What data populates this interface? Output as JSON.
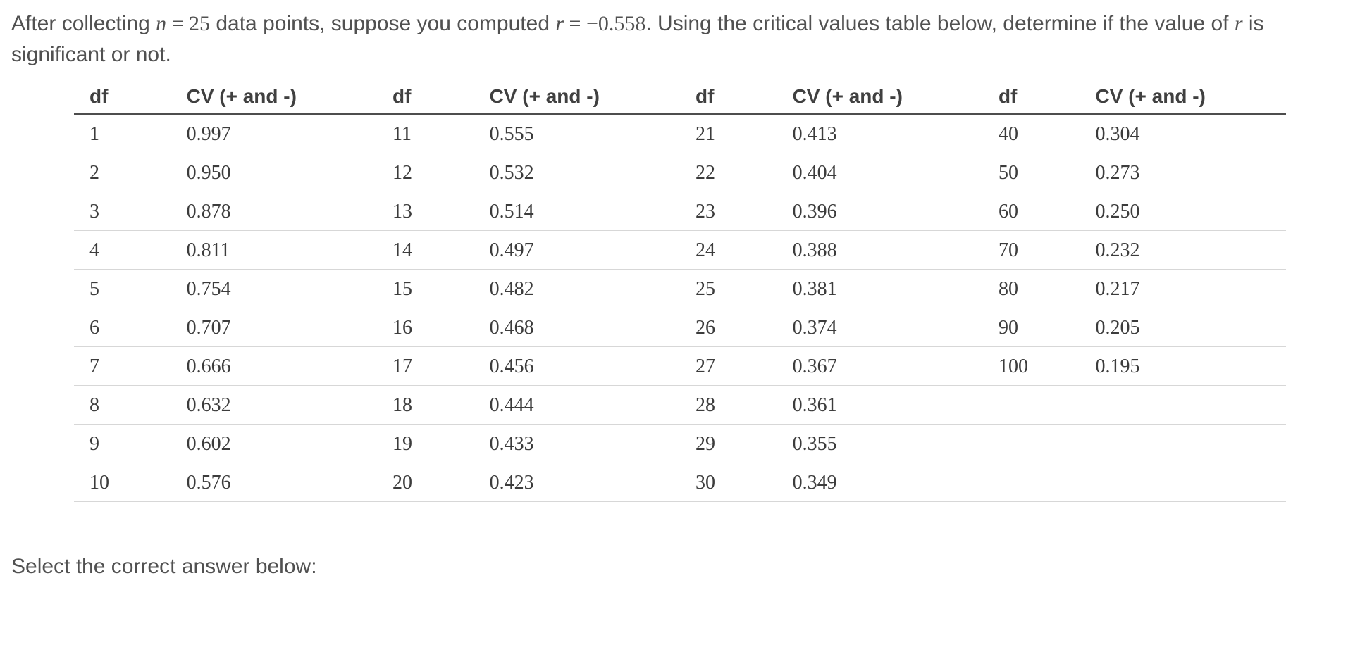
{
  "question": {
    "part1": "After collecting ",
    "n_var": "n",
    "eq1": " = ",
    "n_val": "25",
    "part2": " data points, suppose you computed ",
    "r_var": "r",
    "eq2": " = ",
    "r_val": "−0.558",
    "part3": ". Using the critical values table below, determine if the value of ",
    "r_var2": "r",
    "part4": " is significant or not."
  },
  "headers": {
    "df": "df",
    "cv": "CV (+ and -)"
  },
  "table_rows": [
    {
      "c0_df": "1",
      "c0_cv": "0.997",
      "c1_df": "11",
      "c1_cv": "0.555",
      "c2_df": "21",
      "c2_cv": "0.413",
      "c3_df": "40",
      "c3_cv": "0.304"
    },
    {
      "c0_df": "2",
      "c0_cv": "0.950",
      "c1_df": "12",
      "c1_cv": "0.532",
      "c2_df": "22",
      "c2_cv": "0.404",
      "c3_df": "50",
      "c3_cv": "0.273"
    },
    {
      "c0_df": "3",
      "c0_cv": "0.878",
      "c1_df": "13",
      "c1_cv": "0.514",
      "c2_df": "23",
      "c2_cv": "0.396",
      "c3_df": "60",
      "c3_cv": "0.250"
    },
    {
      "c0_df": "4",
      "c0_cv": "0.811",
      "c1_df": "14",
      "c1_cv": "0.497",
      "c2_df": "24",
      "c2_cv": "0.388",
      "c3_df": "70",
      "c3_cv": "0.232"
    },
    {
      "c0_df": "5",
      "c0_cv": "0.754",
      "c1_df": "15",
      "c1_cv": "0.482",
      "c2_df": "25",
      "c2_cv": "0.381",
      "c3_df": "80",
      "c3_cv": "0.217"
    },
    {
      "c0_df": "6",
      "c0_cv": "0.707",
      "c1_df": "16",
      "c1_cv": "0.468",
      "c2_df": "26",
      "c2_cv": "0.374",
      "c3_df": "90",
      "c3_cv": "0.205"
    },
    {
      "c0_df": "7",
      "c0_cv": "0.666",
      "c1_df": "17",
      "c1_cv": "0.456",
      "c2_df": "27",
      "c2_cv": "0.367",
      "c3_df": "100",
      "c3_cv": "0.195"
    },
    {
      "c0_df": "8",
      "c0_cv": "0.632",
      "c1_df": "18",
      "c1_cv": "0.444",
      "c2_df": "28",
      "c2_cv": "0.361",
      "c3_df": "",
      "c3_cv": ""
    },
    {
      "c0_df": "9",
      "c0_cv": "0.602",
      "c1_df": "19",
      "c1_cv": "0.433",
      "c2_df": "29",
      "c2_cv": "0.355",
      "c3_df": "",
      "c3_cv": ""
    },
    {
      "c0_df": "10",
      "c0_cv": "0.576",
      "c1_df": "20",
      "c1_cv": "0.423",
      "c2_df": "30",
      "c2_cv": "0.349",
      "c3_df": "",
      "c3_cv": ""
    }
  ],
  "footer": {
    "select": "Select the correct answer below:"
  }
}
